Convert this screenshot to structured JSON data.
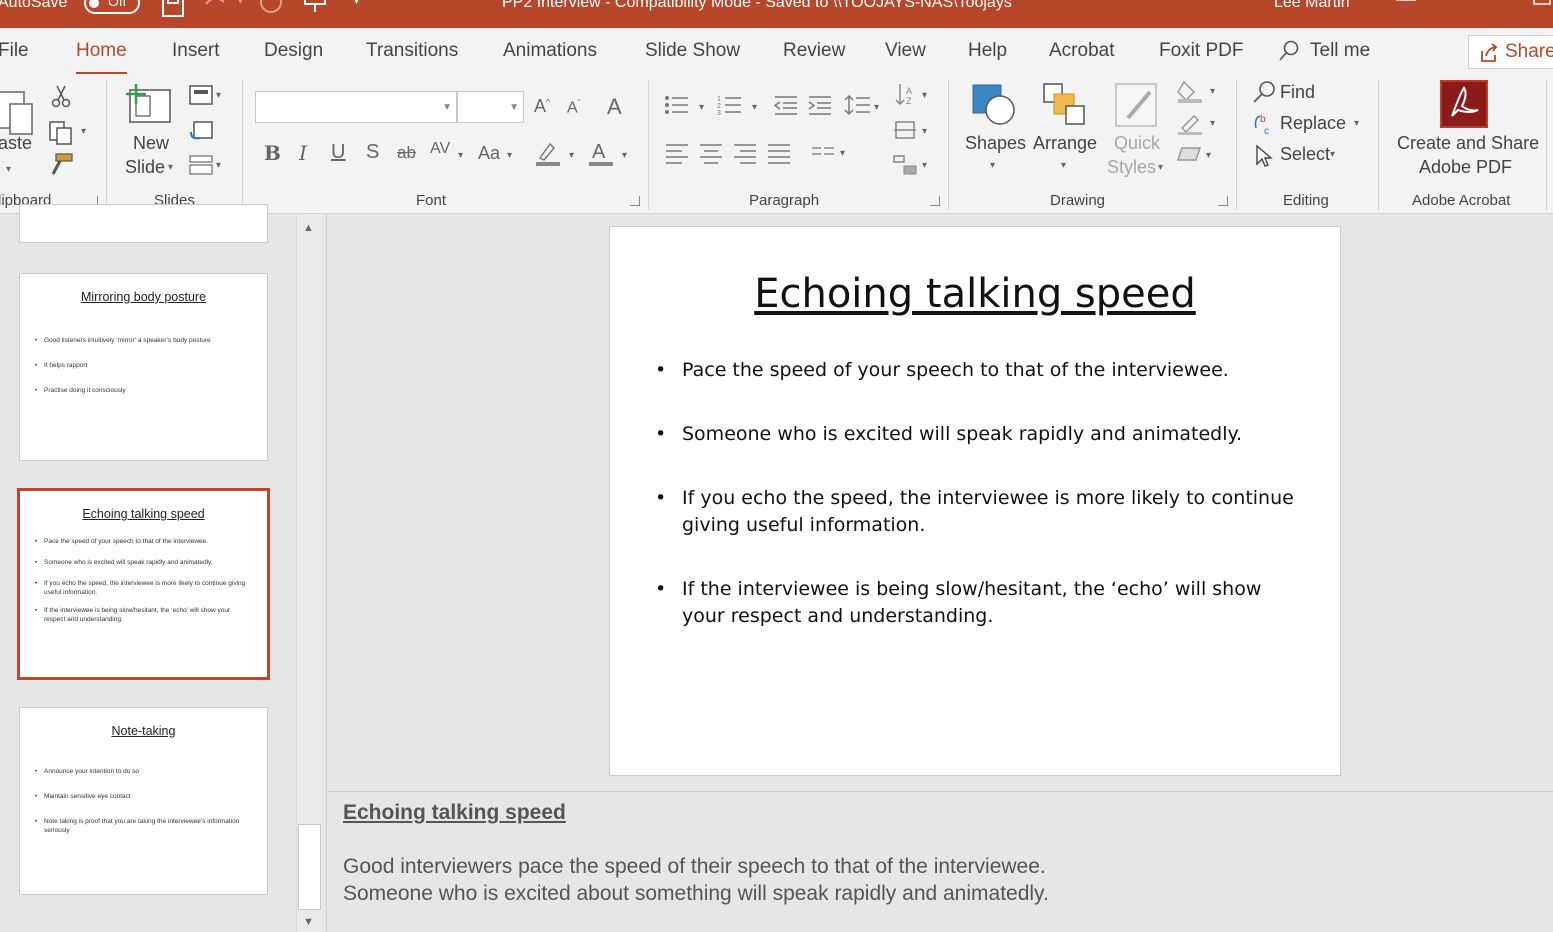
{
  "titlebar": {
    "autosave_label": "AutoSave",
    "autosave_state": "Off",
    "document_title": "PP2 Interview  -  Compatibility Mode  -  Saved to \\\\TOOJAYS-NAS\\Toojays",
    "user_name": "Lee Martin"
  },
  "tabs": [
    "File",
    "Home",
    "Insert",
    "Design",
    "Transitions",
    "Animations",
    "Slide Show",
    "Review",
    "View",
    "Help",
    "Acrobat",
    "Foxit PDF"
  ],
  "active_tab": "Home",
  "tell_me": "Tell me",
  "share_label": "Share",
  "ribbon": {
    "clipboard": {
      "paste_label": "aste",
      "group_label": "lipboard"
    },
    "slides": {
      "new_label": "New",
      "slide_label": "Slide",
      "group_label": "Slides"
    },
    "font": {
      "group_label": "Font"
    },
    "paragraph": {
      "group_label": "Paragraph"
    },
    "drawing": {
      "shapes": "Shapes",
      "arrange": "Arrange",
      "quick": "Quick",
      "styles": "Styles",
      "group_label": "Drawing"
    },
    "editing": {
      "find": "Find",
      "replace": "Replace",
      "select": "Select",
      "group_label": "Editing"
    },
    "acrobat": {
      "line1": "Create and Share",
      "line2": "Adobe PDF",
      "group_label": "Adobe Acrobat"
    }
  },
  "thumbnails": [
    {
      "title": "Mirroring body posture",
      "bullets": [
        "Good listeners intuitively ‘mirror’ a speaker’s body posture",
        "It helps rapport",
        "Practise doing it consciously"
      ]
    },
    {
      "title": "Echoing talking speed",
      "bullets": [
        "Pace the speed of your speech to that of the interviewee.",
        "Someone who is excited will speak rapidly and animatedly.",
        "If you echo the speed, the interviewee is more likely to continue giving useful information.",
        "If the interviewee is being slow/hesitant, the ‘echo’ will show your respect and understanding."
      ]
    },
    {
      "title": "Note-taking",
      "bullets": [
        "Announce your intention to do so",
        "Maintain sensitive eye contact",
        "Note taking is proof that you are taking the interviewee’s information seriously"
      ]
    }
  ],
  "slide": {
    "title": "Echoing talking speed",
    "bullets": [
      "Pace the speed of your speech to that of the interviewee.",
      "Someone who is excited will speak rapidly and animatedly.",
      "If you echo the speed, the interviewee is more likely to continue giving useful information.",
      "If the interviewee is being slow/hesitant, the ‘echo’ will show your respect and understanding."
    ]
  },
  "notes": {
    "title": "Echoing talking speed",
    "lines": [
      "Good interviewers pace the speed of their speech to that of the interviewee.",
      "Someone who is excited about something will speak rapidly and animatedly."
    ]
  },
  "colors": {
    "accent": "#b7472a",
    "selection_border": "#c1432a",
    "acrobat_red": "#8b1b1b"
  }
}
